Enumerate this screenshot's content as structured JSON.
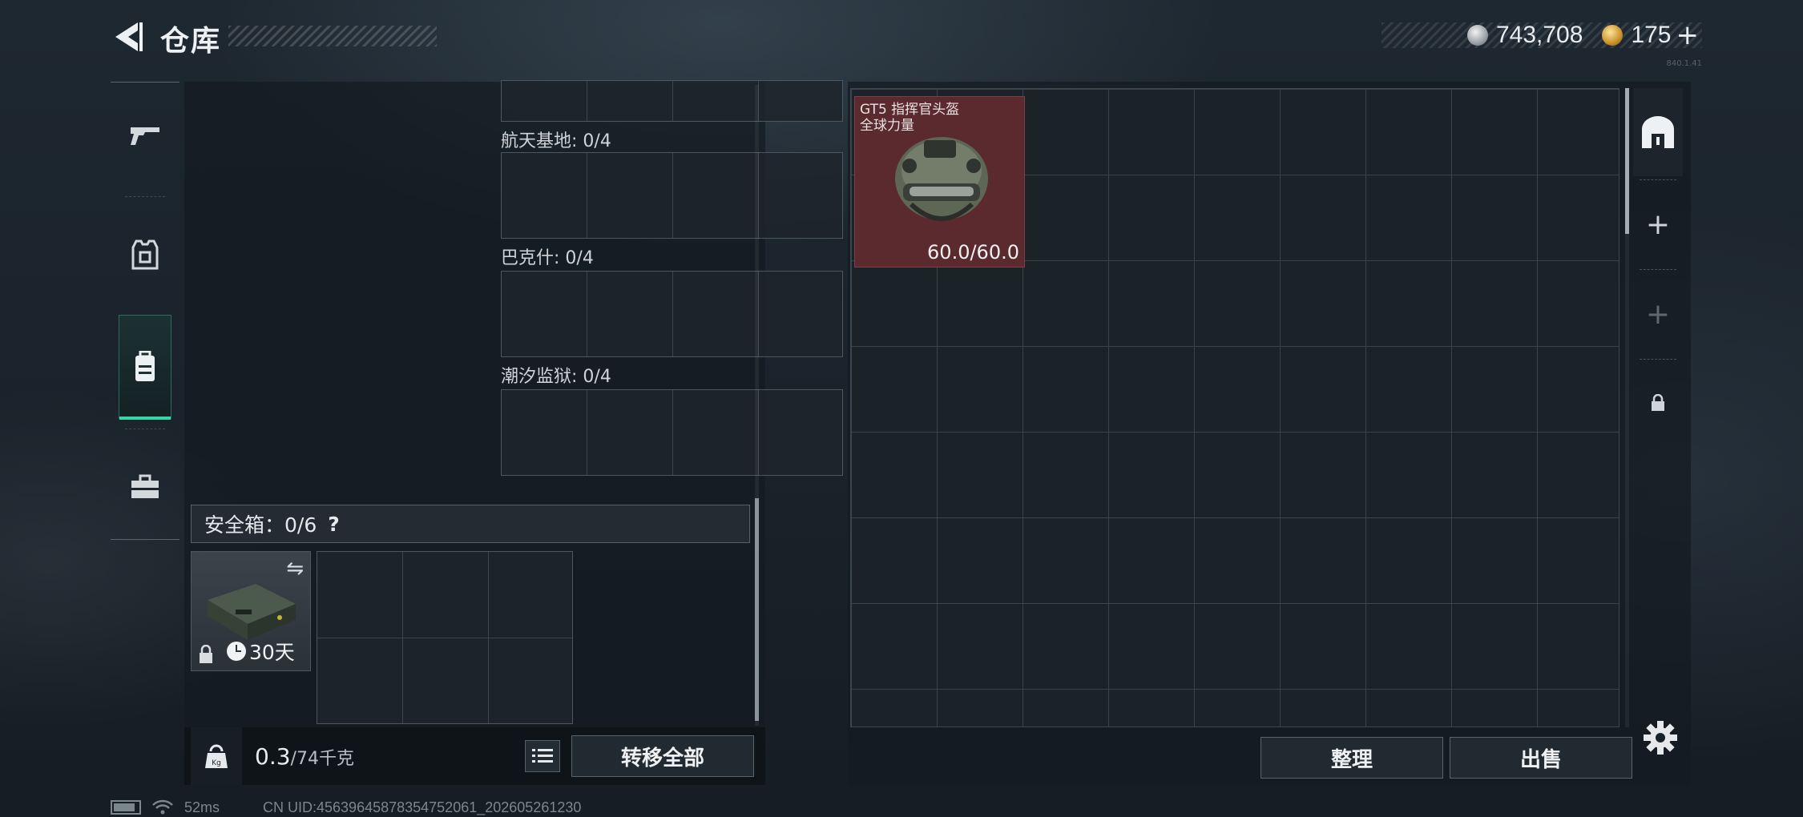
{
  "header": {
    "title": "仓库",
    "currency": [
      {
        "icon": "silver-coin-icon",
        "value": "743,708"
      },
      {
        "icon": "gold-coin-icon",
        "value": "175"
      }
    ],
    "topup_label": "+",
    "version": "840.1.41"
  },
  "rail": {
    "items": [
      {
        "icon": "gun-icon",
        "active": false
      },
      {
        "icon": "armor-vest-icon",
        "active": false
      },
      {
        "icon": "backpack-icon",
        "active": true
      },
      {
        "icon": "briefcase-icon",
        "active": false
      }
    ]
  },
  "left": {
    "sections": [
      {
        "label": "航天基地: 0/4"
      },
      {
        "label": "巴克什: 0/4"
      },
      {
        "label": "潮汐监狱: 0/4"
      }
    ],
    "safe": {
      "title": "安全箱：0/6",
      "help": "?",
      "duration": "30天"
    },
    "weight": {
      "current": "0.3",
      "max": "/74千克"
    },
    "transfer_all_label": "转移全部"
  },
  "right": {
    "item": {
      "name_line1": "GT5 指挥官头盔",
      "name_line2": "全球力量",
      "durability": "60.0/60.0"
    },
    "side_tabs": [
      {
        "icon": "stash-icon",
        "label": ""
      },
      {
        "icon": "plus-icon",
        "label": "+"
      },
      {
        "icon": "plus-icon",
        "label": "+"
      },
      {
        "icon": "lock-icon",
        "label": ""
      }
    ],
    "tidy_label": "整理",
    "sell_label": "出售"
  },
  "status": {
    "ping": "52ms",
    "uid": "CN UID:456396458783547520​61_202605261230"
  },
  "colors": {
    "accent": "#37d6a6",
    "item_rarity_bg": "#5b2a2f"
  }
}
